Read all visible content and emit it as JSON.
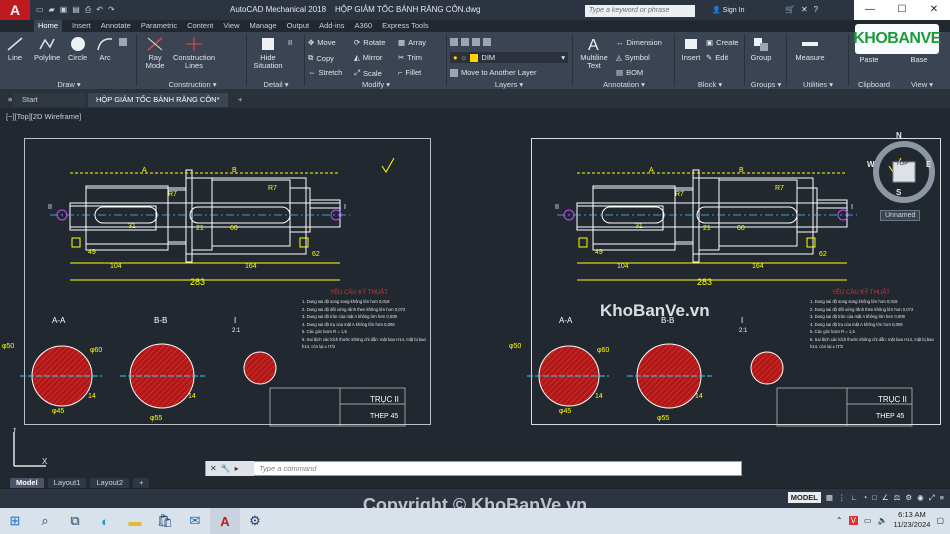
{
  "app": {
    "title": "AutoCAD Mechanical 2018",
    "document": "HỘP GIẢM TỐC BÁNH RĂNG CÔN.dwg",
    "logo_letter": "A",
    "search_placeholder": "Type a keyword or phrase",
    "sign_in": "Sign In"
  },
  "ribbon_tabs": [
    "Home",
    "Insert",
    "Annotate",
    "Parametric",
    "Content",
    "View",
    "Manage",
    "Output",
    "Add-ins",
    "A360",
    "Express Tools"
  ],
  "ribbon": {
    "draw": {
      "title": "Draw ▾",
      "tools": [
        "Line",
        "Polyline",
        "Circle",
        "Arc"
      ]
    },
    "construction": {
      "title": "Construction ▾",
      "tools": [
        "Ray Mode",
        "Construction Lines"
      ]
    },
    "detail": {
      "title": "Detail ▾",
      "tools": [
        "Hide Situation"
      ]
    },
    "modify": {
      "title": "Modify ▾",
      "tools": [
        "Move",
        "Rotate",
        "Array",
        "Copy",
        "Mirror",
        "Trim",
        "Stretch",
        "Scale",
        "Fillet"
      ]
    },
    "layers": {
      "title": "Layers ▾",
      "layer_name": "DIM",
      "move_label": "Move to Another Layer"
    },
    "annotation": {
      "title": "Annotation ▾",
      "tools": [
        "Multiline Text",
        "Dimension",
        "Symbol",
        "BOM"
      ]
    },
    "block": {
      "title": "Block ▾",
      "tools": [
        "Insert",
        "Create",
        "Edit"
      ]
    },
    "groups": {
      "title": "Groups ▾",
      "tools": [
        "Group"
      ]
    },
    "utilities": {
      "title": "Utilities ▾",
      "tools": [
        "Measure"
      ]
    },
    "clipboard": {
      "title": "Clipboard",
      "tools": [
        "Paste"
      ]
    },
    "view": {
      "title": "View ▾",
      "tools": [
        "Base"
      ]
    }
  },
  "brand_logo": "KHOBANVE",
  "doc_tabs": {
    "start": "Start",
    "active": "HỘP GIẢM TỐC BÁNH RĂNG CÔN*"
  },
  "viewport_label": "[−][Top][2D Wireframe]",
  "viewcube": {
    "n": "N",
    "s": "S",
    "e": "E",
    "w": "W",
    "face": "TOP",
    "ucs": "Unnamed"
  },
  "drawing": {
    "title": "TRỤC II",
    "material": "THEP 45",
    "requirements_title": "YÊU CẦU KỸ THUẬT",
    "requirements": [
      "1. Dung sai độ song song không lớn hơn 0,018",
      "2. Dung sai độ đối xứng rãnh then không lớn hơn 0,072",
      "3. Dung sai độ tròn của mặt A không lớn hơn 0,008",
      "4. Dung sai độ trụ của mặt A không lớn hơn 0,008",
      "5. Các góc lượn R = 1,5",
      "6. Sai lệch các kích thước không chỉ dẫn: mặt bao H14, mặt bị bao h14, còn lại ± IT/2"
    ],
    "section_labels": [
      "A-A",
      "B-B",
      "I",
      "2:1"
    ],
    "dims": [
      "49",
      "104",
      "31",
      "21",
      "60",
      "164",
      "62",
      "283",
      "R7",
      "R7",
      "φ45",
      "φ55",
      "φ50",
      "φ60",
      "14",
      "14"
    ],
    "markers": [
      "A",
      "B",
      "I",
      "II"
    ]
  },
  "watermark": "KhoBanVe.vn",
  "command_placeholder": "Type a command",
  "layout_tabs": [
    "Model",
    "Layout1",
    "Layout2",
    "+"
  ],
  "status": {
    "model": "MODEL"
  },
  "copyright": "Copyright © KhoBanVe.vn",
  "clock": {
    "time": "6:13 AM",
    "date": "11/23/2024"
  },
  "colors": {
    "accent": "#c01a21",
    "drawing_yellow": "#ffff00",
    "hatch_red": "#b01818"
  }
}
